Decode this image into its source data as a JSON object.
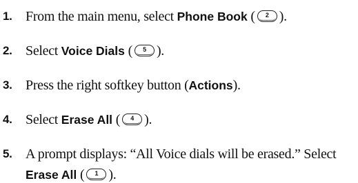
{
  "steps": [
    {
      "number": "1.",
      "pre": "From the main menu, select ",
      "bold": "Phone Book",
      "paren_open": " (",
      "key": "2",
      "paren_close": ")."
    },
    {
      "number": "2.",
      "pre": "Select ",
      "bold": "Voice Dials",
      "paren_open": " (",
      "key": "5",
      "paren_close": ")."
    },
    {
      "number": "3.",
      "pre": "Press the right softkey button (",
      "bold": "Actions",
      "post": ")."
    },
    {
      "number": "4.",
      "pre": "Select ",
      "bold": "Erase All",
      "paren_open": " (",
      "key": "4",
      "paren_close": ")."
    },
    {
      "number": "5.",
      "line1": "A prompt displays: “All Voice dials will be erased.” Select",
      "bold": "Erase All",
      "paren_open": " (",
      "key": "1",
      "paren_close": ")."
    }
  ],
  "icons": {
    "key_button": "phone-keypad-key-icon"
  }
}
